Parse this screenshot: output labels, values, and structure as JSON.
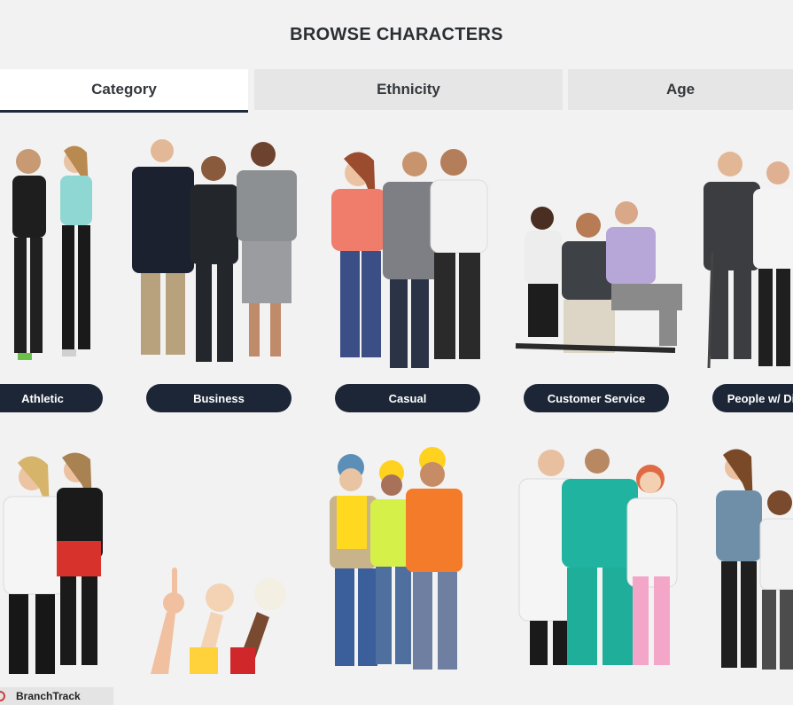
{
  "header": {
    "title": "BROWSE CHARACTERS"
  },
  "tabs": [
    {
      "label": "Category",
      "active": true
    },
    {
      "label": "Ethnicity",
      "active": false
    },
    {
      "label": "Age",
      "active": false
    }
  ],
  "categories_row1": [
    {
      "label": "Athletic"
    },
    {
      "label": "Business"
    },
    {
      "label": "Casual"
    },
    {
      "label": "Customer Service"
    },
    {
      "label": "People w/ Di"
    }
  ],
  "footer": {
    "brand": "BranchTrack"
  },
  "colors": {
    "pill": "#1c2636",
    "active_tab_underline": "#1f2b3a",
    "brand_logo": "#d23b3b"
  }
}
